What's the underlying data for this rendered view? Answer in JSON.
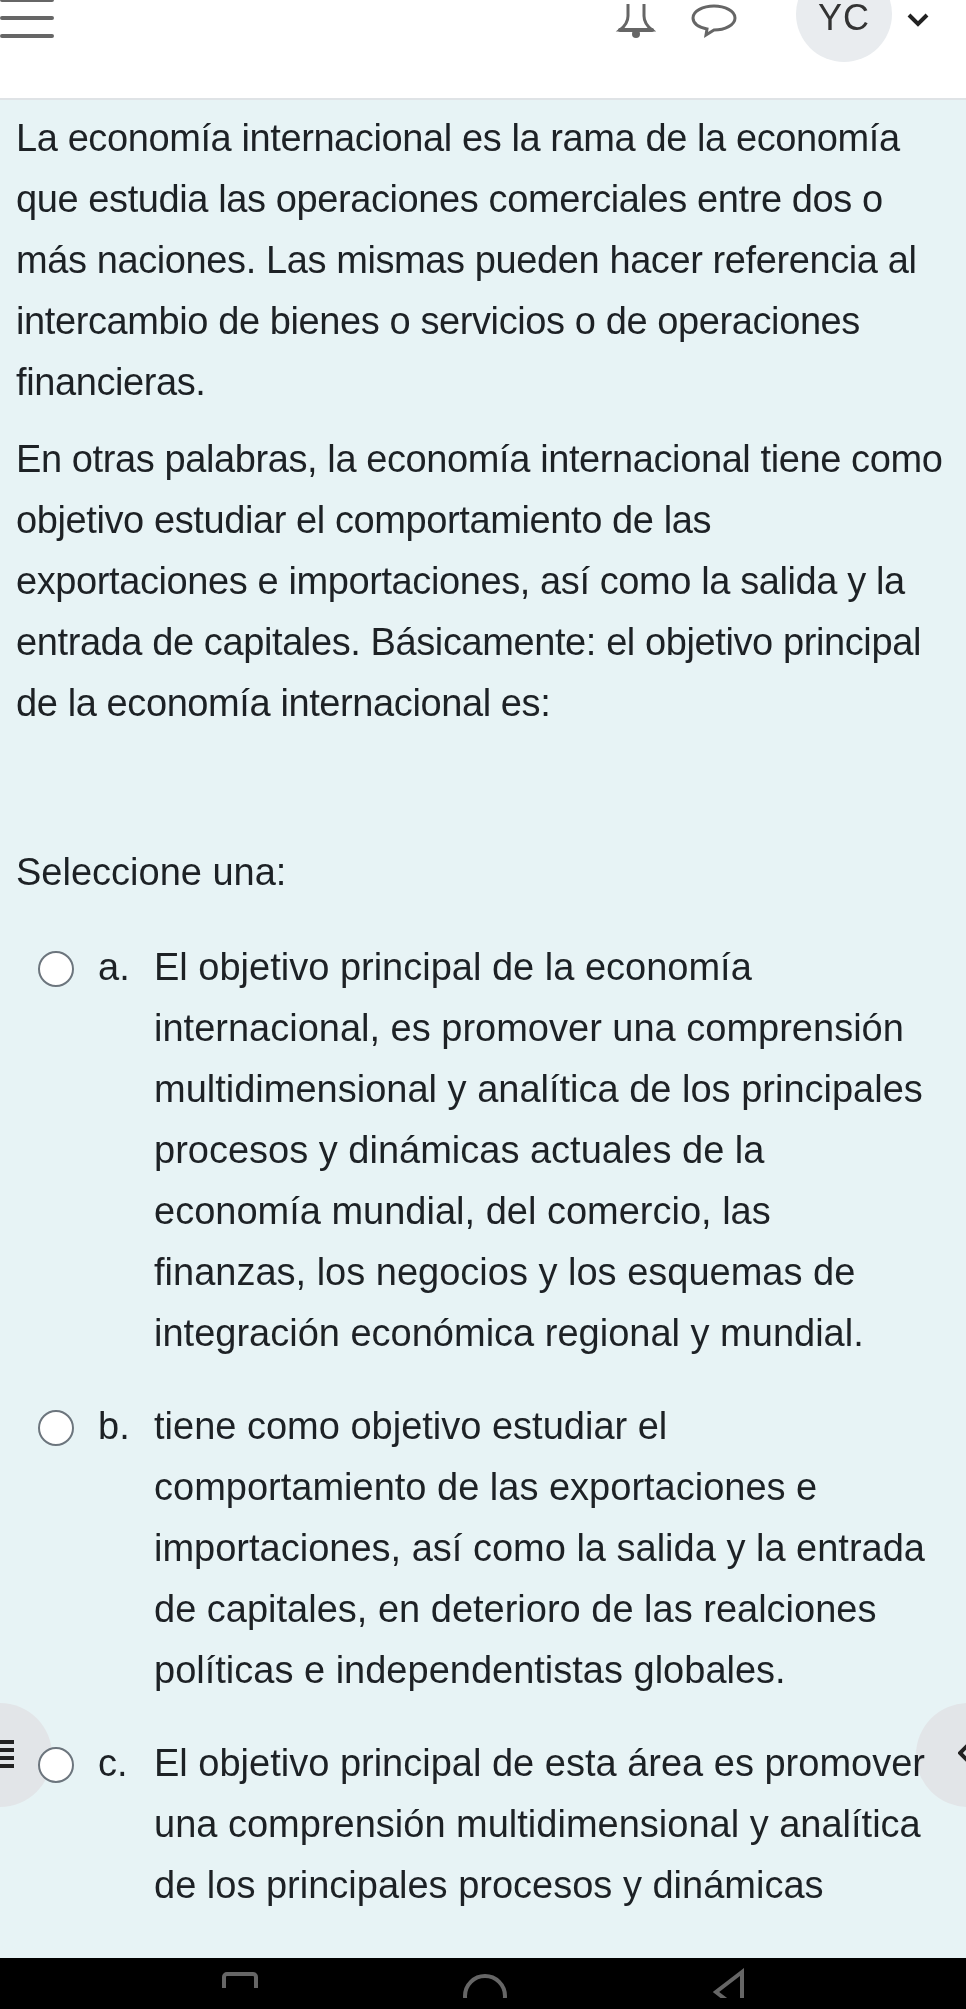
{
  "header": {
    "avatar": {
      "initials": "YC"
    }
  },
  "question": {
    "paragraphs": [
      "La economía internacional es la rama de la economía que estudia las operaciones comerciales entre dos o más naciones. Las mismas pueden hacer referencia al intercambio de bienes o servicios o de operaciones financieras.",
      "En otras palabras, la economía internacional tiene como objetivo estudiar el comportamiento de las exportaciones e importaciones, así como la salida y la entrada de capitales. Básicamente: el objetivo principal de la economía internacional es:"
    ],
    "prompt": "Seleccione una:",
    "options": [
      {
        "letter": "a.",
        "text": "El objetivo principal de la economía internacional, es promover una comprensión multidimensional y analítica de los principales procesos y dinámicas actuales de la economía mundial, del comercio, las finanzas, los negocios y los esquemas de integración económica regional y mundial.",
        "selected": false
      },
      {
        "letter": "b.",
        "text": "tiene como objetivo estudiar el comportamiento de las exportaciones e importaciones, así como la salida y la entrada de capitales, en deterioro de las realciones políticas e independentistas globales.",
        "selected": false
      },
      {
        "letter": "c.",
        "text": "El objetivo principal de esta área es promover una comprensión multidimensional y analítica de los principales procesos y dinámicas",
        "selected": false
      }
    ]
  }
}
